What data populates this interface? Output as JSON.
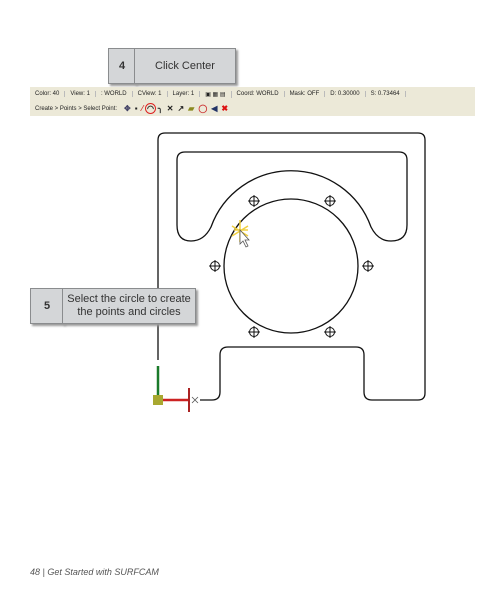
{
  "callouts": {
    "step4_number": "4",
    "step4_text": "Click Center",
    "step5_number": "5",
    "step5_text": "Select the circle to create the points and circles"
  },
  "toolbar1": {
    "color": "Color: 40",
    "view": "View: 1",
    "world": ": WORLD",
    "cview": "CView: 1",
    "layer": "Layer: 1",
    "coord": "Coord: WORLD",
    "mask": "Mask: OFF",
    "d": "D: 0.30000",
    "s": "S: 0.73464"
  },
  "toolbar2": {
    "breadcrumb": "Create > Points > Select Point:"
  },
  "footer": {
    "text": "48  |  Get Started with SURFCAM"
  }
}
